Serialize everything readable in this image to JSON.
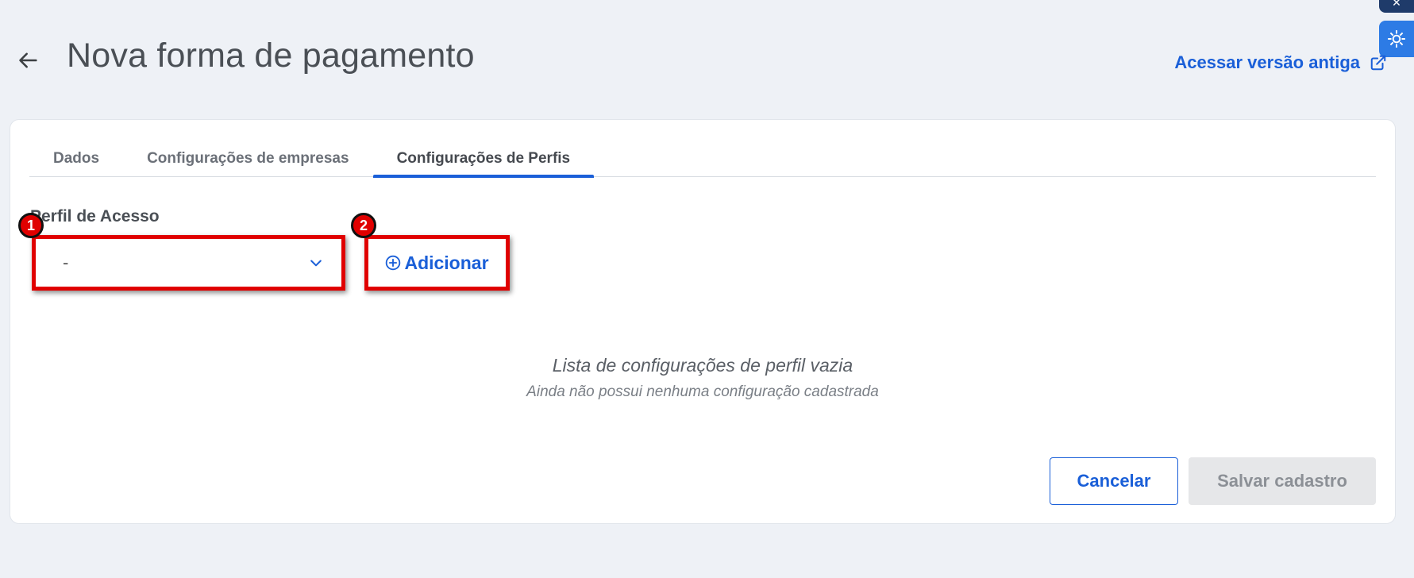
{
  "header": {
    "title": "Nova forma de pagamento",
    "old_version_link": "Acessar versão antiga"
  },
  "tabs": [
    {
      "label": "Dados",
      "active": false
    },
    {
      "label": "Configurações de empresas",
      "active": false
    },
    {
      "label": "Configurações de Perfis",
      "active": true
    }
  ],
  "form": {
    "profile_label": "Perfil de Acesso",
    "profile_value": "-",
    "add_label": "Adicionar"
  },
  "annotations": {
    "step1": "1",
    "step2": "2"
  },
  "empty_state": {
    "title": "Lista de configurações de perfil vazia",
    "subtitle": "Ainda não possui nenhuma configuração cadastrada"
  },
  "footer": {
    "cancel_label": "Cancelar",
    "save_label": "Salvar cadastro"
  },
  "icons": {
    "back": "arrow-left-icon",
    "external": "external-link-icon",
    "dropdown": "chevron-down-icon",
    "add": "plus-circle-icon",
    "ai": "ai-assistant-icon"
  },
  "colors": {
    "accent": "#1a5fd8",
    "annotation": "#e00000",
    "background": "#eef1f6",
    "disabled_button": "#e6e7e9"
  }
}
